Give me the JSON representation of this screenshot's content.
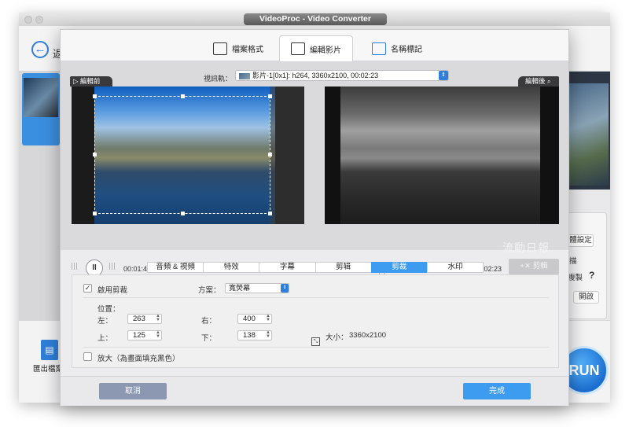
{
  "background_window": {
    "title": "VideoProc - Video Converter",
    "back_partial_label": "返",
    "export_label": "匯出檔案格",
    "right_settings_label": "體設定",
    "right_label_1": "描",
    "right_label_2": "複製",
    "help_label": "?",
    "open_label": "開啟",
    "run_label": "RUN"
  },
  "dialog": {
    "tabs": [
      {
        "label": "檔案格式",
        "icon": "file-format-icon"
      },
      {
        "label": "編輯影片",
        "icon": "edit-video-icon"
      },
      {
        "label": "名稱標記",
        "icon": "name-tag-icon"
      }
    ],
    "active_tab": "編輯影片",
    "video_track_label": "視訊軌：",
    "video_track_value": "影片-1[0x1]: h264, 3360x2100, 00:02:23",
    "before_label": "▷ 編輯前",
    "after_label": "編輯後",
    "watermark_text": "流動日報",
    "playback": {
      "pause_symbol": "II",
      "current_time": "00:01:44",
      "end_time": "00:02:23",
      "progress": 0.73,
      "clip_button": "+✕ 剪輯"
    },
    "edit_tabs": [
      "音頻 & 視頻",
      "特效",
      "字幕",
      "剪辑",
      "剪裁",
      "水印"
    ],
    "active_edit_tab": "剪裁",
    "crop": {
      "enable_label": "啟用剪裁",
      "enable_checked": "✓",
      "scheme_label": "方案：",
      "scheme_value": "寬熒幕",
      "position_label": "位置：",
      "left_label": "左：",
      "left_value": "263",
      "right_label": "右：",
      "right_value": "400",
      "top_label": "上：",
      "top_value": "125",
      "bottom_label": "下：",
      "bottom_value": "138",
      "size_label": "大小：",
      "size_value": "3360x2100",
      "zoom_label": "放大（為畫面填充黑色）"
    },
    "footer": {
      "cancel_label": "取消",
      "done_label": "完成"
    }
  },
  "colors": {
    "accent_blue": "#3d9bf0",
    "cancel_gray_blue": "#8c98b1",
    "title_pill": "#5e5e5e"
  }
}
